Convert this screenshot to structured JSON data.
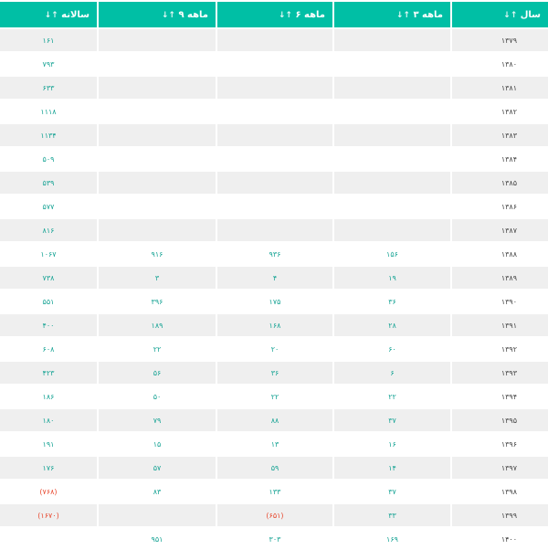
{
  "headers": {
    "col1": "سالانه",
    "col2": "۹ ماهه",
    "col3": "۶ ماهه",
    "col4": "۳ ماهه",
    "col5": "سال",
    "sort_glyph": "↓↑"
  },
  "rows": [
    {
      "year": "۱۳۷۹",
      "q3": "",
      "q6": "",
      "q9": "",
      "annual": "۱۶۱"
    },
    {
      "year": "۱۳۸۰",
      "q3": "",
      "q6": "",
      "q9": "",
      "annual": "۷۹۳"
    },
    {
      "year": "۱۳۸۱",
      "q3": "",
      "q6": "",
      "q9": "",
      "annual": "۶۳۳"
    },
    {
      "year": "۱۳۸۲",
      "q3": "",
      "q6": "",
      "q9": "",
      "annual": "۱۱۱۸"
    },
    {
      "year": "۱۳۸۳",
      "q3": "",
      "q6": "",
      "q9": "",
      "annual": "۱۱۳۴"
    },
    {
      "year": "۱۳۸۴",
      "q3": "",
      "q6": "",
      "q9": "",
      "annual": "۵۰۹"
    },
    {
      "year": "۱۳۸۵",
      "q3": "",
      "q6": "",
      "q9": "",
      "annual": "۵۳۹"
    },
    {
      "year": "۱۳۸۶",
      "q3": "",
      "q6": "",
      "q9": "",
      "annual": "۵۷۷"
    },
    {
      "year": "۱۳۸۷",
      "q3": "",
      "q6": "",
      "q9": "",
      "annual": "۸۱۶"
    },
    {
      "year": "۱۳۸۸",
      "q3": "۱۵۶",
      "q6": "۹۳۶",
      "q9": "۹۱۶",
      "annual": "۱۰۶۷"
    },
    {
      "year": "۱۳۸۹",
      "q3": "۱۹",
      "q6": "۴",
      "q9": "۳",
      "annual": "۷۳۸"
    },
    {
      "year": "۱۳۹۰",
      "q3": "۳۶",
      "q6": "۱۷۵",
      "q9": "۳۹۶",
      "annual": "۵۵۱"
    },
    {
      "year": "۱۳۹۱",
      "q3": "۲۸",
      "q6": "۱۶۸",
      "q9": "۱۸۹",
      "annual": "۴۰۰"
    },
    {
      "year": "۱۳۹۲",
      "q3": "۶۰",
      "q6": "۲۰",
      "q9": "۲۲",
      "annual": "۶۰۸"
    },
    {
      "year": "۱۳۹۳",
      "q3": "۶",
      "q6": "۳۶",
      "q9": "۵۶",
      "annual": "۴۲۳"
    },
    {
      "year": "۱۳۹۴",
      "q3": "۲۲",
      "q6": "۲۲",
      "q9": "۵۰",
      "annual": "۱۸۶"
    },
    {
      "year": "۱۳۹۵",
      "q3": "۳۷",
      "q6": "۸۸",
      "q9": "۷۹",
      "annual": "۱۸۰"
    },
    {
      "year": "۱۳۹۶",
      "q3": "۱۶",
      "q6": "۱۳",
      "q9": "۱۵",
      "annual": "۱۹۱"
    },
    {
      "year": "۱۳۹۷",
      "q3": "۱۴",
      "q6": "۵۹",
      "q9": "۵۷",
      "annual": "۱۷۶"
    },
    {
      "year": "۱۳۹۸",
      "q3": "۳۷",
      "q6": "۱۳۳",
      "q9": "۸۳",
      "annual": "(۷۶۸)"
    },
    {
      "year": "۱۳۹۹",
      "q3": "۳۳",
      "q6": "(۶۵۱)",
      "q9": "",
      "annual": "(۱۶۷۰)"
    },
    {
      "year": "۱۴۰۰",
      "q3": "۱۶۹",
      "q6": "۳۰۳",
      "q9": "۹۵۱",
      "annual": ""
    }
  ],
  "colors": {
    "header_bg": "#00bfa5",
    "value": "#16a394",
    "negative": "#e8492f",
    "stripe": "#efefef"
  }
}
